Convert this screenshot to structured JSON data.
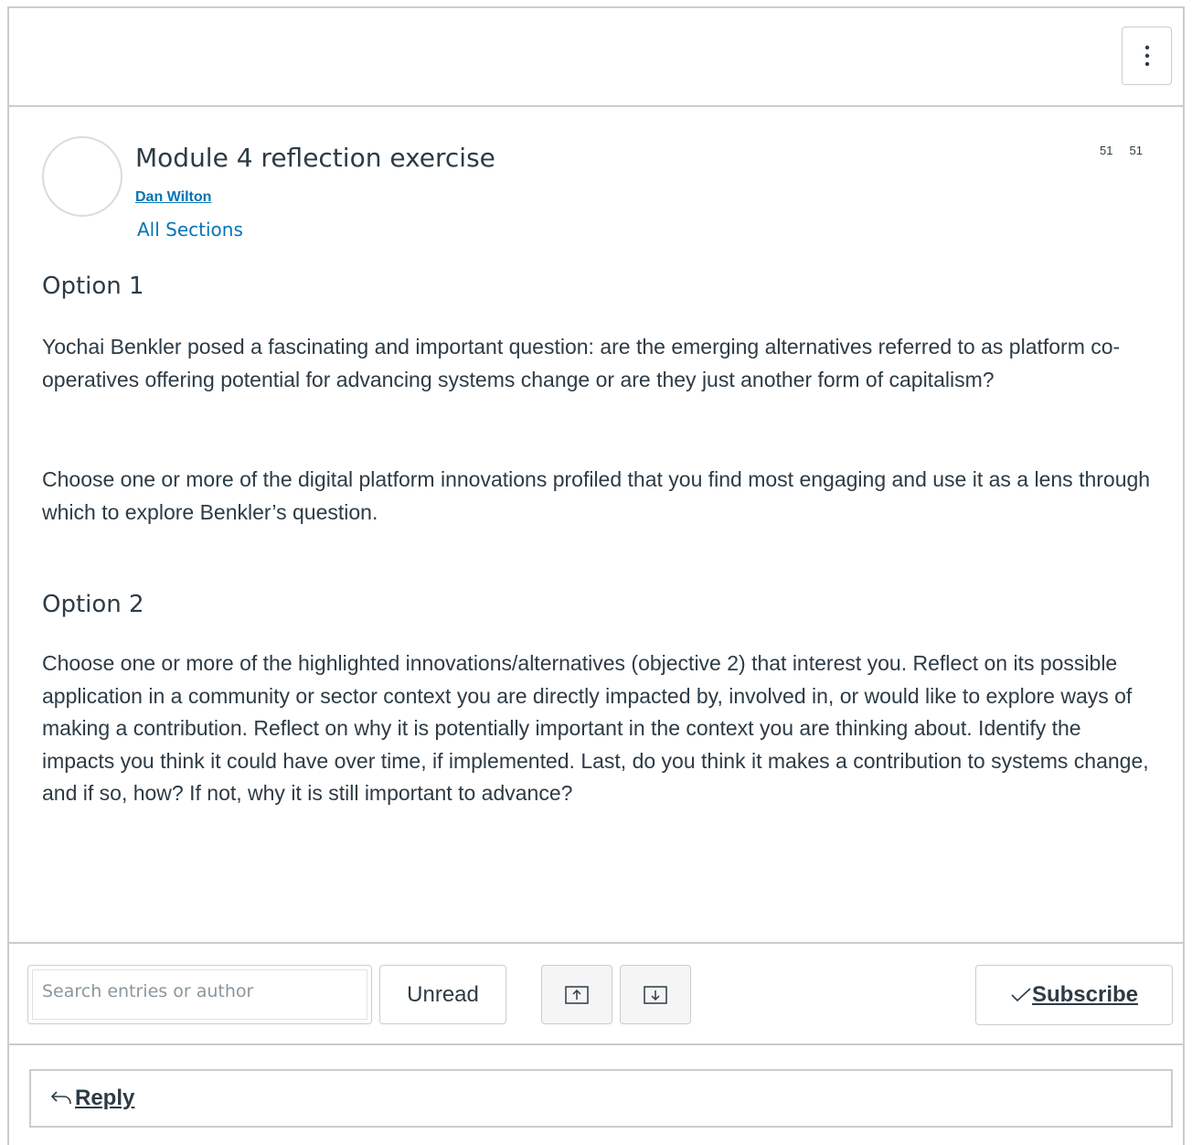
{
  "topic": {
    "title": "Module 4 reflection exercise",
    "author": "Dan Wilton",
    "sections": "All Sections",
    "count_a": "51",
    "count_b": "51"
  },
  "body": {
    "option1_heading": "Option 1",
    "option1_p1": "Yochai Benkler posed a fascinating and important question: are the emerging alternatives referred to as platform co-operatives offering potential for advancing systems change or are they just another form of capitalism?",
    "option1_p2": "Choose one or more of the digital platform innovations profiled that you find most engaging and use it as a lens through which to explore Benkler’s question.",
    "option2_heading": "Option 2",
    "option2_p1": "Choose one or more of the highlighted innovations/alternatives (objective 2) that interest you. Reflect on its possible application in a community or sector context you are directly impacted by, involved in, or would like to explore ways of making a contribution. Reflect on why it is potentially important in the context you are thinking about. Identify the impacts you think it could have over time, if implemented. Last, do you think it makes a contribution to systems change, and if so, how? If not, why it is still important to advance?"
  },
  "toolbar": {
    "search_placeholder": "Search entries or author",
    "search_value": "",
    "unread_label": "Unread",
    "subscribe_label": "Subscribe"
  },
  "reply": {
    "label": "Reply"
  },
  "icons": {
    "menu": "kebab-menu-icon",
    "sort_up": "arrow-up-icon",
    "sort_down": "arrow-down-icon",
    "subscribe": "checkmark-icon",
    "reply": "reply-arrow-icon"
  },
  "colors": {
    "link": "#0374b5",
    "text": "#2d3b45",
    "border": "#c7cdd1"
  }
}
